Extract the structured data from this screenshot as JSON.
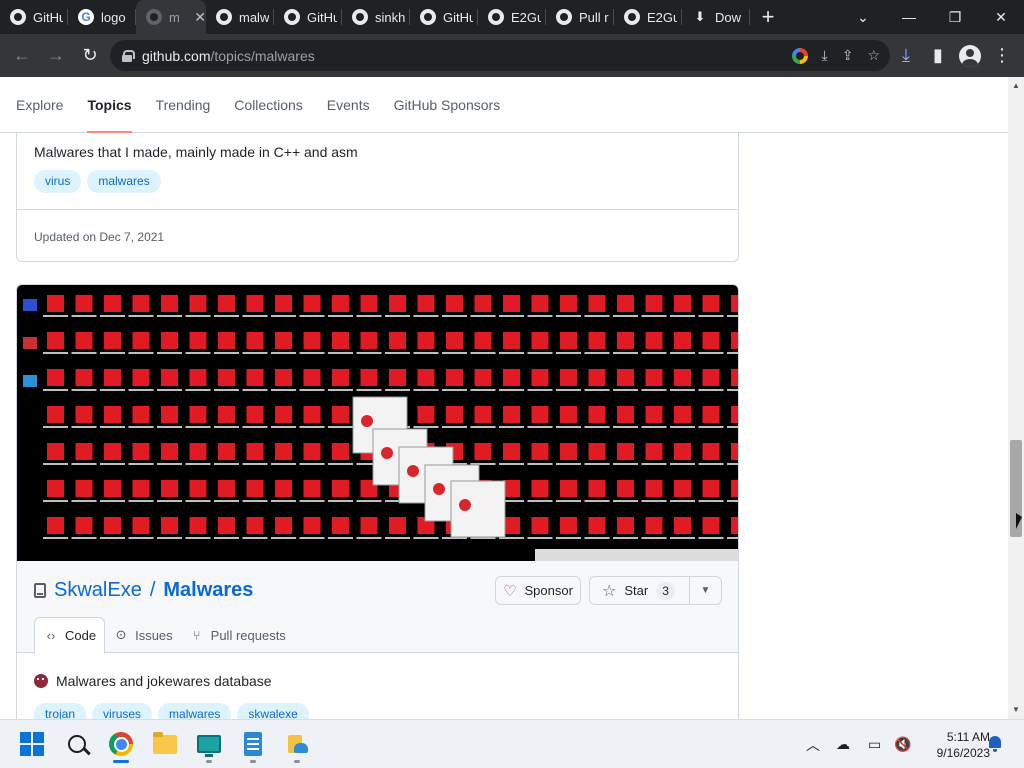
{
  "browser": {
    "tabs": [
      {
        "title": "GitHu",
        "favicon": "github-icon",
        "active": false,
        "closable": false
      },
      {
        "title": "logo",
        "favicon": "google-icon",
        "active": false,
        "closable": false
      },
      {
        "title": "m",
        "favicon": "github-icon",
        "active": true,
        "closable": true
      },
      {
        "title": "malw",
        "favicon": "github-icon",
        "active": false,
        "closable": false
      },
      {
        "title": "GitHu",
        "favicon": "github-icon",
        "active": false,
        "closable": false
      },
      {
        "title": "sinkh",
        "favicon": "github-icon",
        "active": false,
        "closable": false
      },
      {
        "title": "GitHu",
        "favicon": "github-icon",
        "active": false,
        "closable": false
      },
      {
        "title": "E2Gu",
        "favicon": "github-icon",
        "active": false,
        "closable": false
      },
      {
        "title": "Pull r",
        "favicon": "github-icon",
        "active": false,
        "closable": false
      },
      {
        "title": "E2Gu",
        "favicon": "github-icon",
        "active": false,
        "closable": false
      },
      {
        "title": "Dow",
        "favicon": "download-icon",
        "active": false,
        "closable": false
      }
    ],
    "new_tab_glyph": "+",
    "window_controls": {
      "tab_search": "⌄",
      "minimize": "—",
      "restore": "❐",
      "close": "✕"
    },
    "nav": {
      "back": "←",
      "forward": "→",
      "reload": "↻"
    },
    "url_domain": "github.com",
    "url_path": "/topics/malwares",
    "omnibox_icons": [
      "google-lens-icon",
      "install-icon",
      "share-icon",
      "bookmark-star-icon"
    ],
    "toolbar_icons": {
      "download": "⤓",
      "side_panel": "▮",
      "menu": "⋮"
    }
  },
  "github": {
    "subnav": [
      "Explore",
      "Topics",
      "Trending",
      "Collections",
      "Events",
      "GitHub Sponsors"
    ],
    "active_subnav": "Topics",
    "card1": {
      "description": "Malwares that I made, mainly made in C++ and asm",
      "topics": [
        "virus",
        "malwares"
      ],
      "updated": "Updated on Dec 7, 2021"
    },
    "card2": {
      "owner": "SkwalExe",
      "separator": "/",
      "repo": "Malwares",
      "sponsor_label": "Sponsor",
      "star_label": "Star",
      "star_count": "3",
      "tabs": [
        "Code",
        "Issues",
        "Pull requests"
      ],
      "description": "Malwares and jokewares database",
      "topics": [
        "trojan",
        "viruses",
        "malwares",
        "skwalexe"
      ]
    }
  },
  "taskbar": {
    "apps": [
      "windows-start",
      "search",
      "chrome",
      "file-explorer",
      "remote-desktop",
      "notepad",
      "app"
    ],
    "tray": {
      "chevron": "︿",
      "time": "5:11 AM",
      "date": "9/16/2023"
    }
  },
  "colors": {
    "link_blue": "#0969da",
    "topic_bg": "#ddf4ff",
    "active_tab_underline": "#fd8c73",
    "chrome_dark": "#202124",
    "toolbar": "#35363a"
  }
}
